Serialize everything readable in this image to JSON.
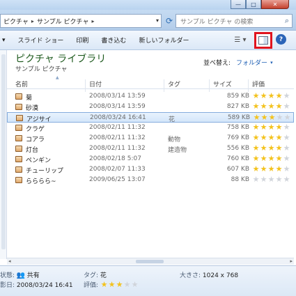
{
  "address": {
    "segments": [
      "ピクチャ",
      "サンプル ピクチャ"
    ],
    "search_placeholder": "サンプル ピクチャ の検索"
  },
  "toolbar": {
    "organize_caret": "▾",
    "slideshow": "スライド ショー",
    "print": "印刷",
    "burn": "書き込む",
    "new_folder": "新しいフォルダー",
    "help": "?"
  },
  "library": {
    "title": "ピクチャ ライブラリ",
    "subtitle": "サンプル ピクチャ",
    "arrange_label": "並べ替え:",
    "arrange_value": "フォルダー"
  },
  "columns": {
    "name": "名前",
    "date": "日付",
    "tag": "タグ",
    "size": "サイズ",
    "rating": "評価"
  },
  "files": [
    {
      "name": "菊",
      "date": "2008/03/14 13:59",
      "tag": "",
      "size": "859 KB",
      "rating": 4
    },
    {
      "name": "砂漠",
      "date": "2008/03/14 13:59",
      "tag": "",
      "size": "827 KB",
      "rating": 4
    },
    {
      "name": "アジサイ",
      "date": "2008/03/24 16:41",
      "tag": "花",
      "size": "589 KB",
      "rating": 3,
      "selected": true
    },
    {
      "name": "クラゲ",
      "date": "2008/02/11 11:32",
      "tag": "",
      "size": "758 KB",
      "rating": 4
    },
    {
      "name": "コアラ",
      "date": "2008/02/11 11:32",
      "tag": "動物",
      "size": "769 KB",
      "rating": 4
    },
    {
      "name": "灯台",
      "date": "2008/02/11 11:32",
      "tag": "建造物",
      "size": "556 KB",
      "rating": 4
    },
    {
      "name": "ペンギン",
      "date": "2008/02/18 5:07",
      "tag": "",
      "size": "760 KB",
      "rating": 4
    },
    {
      "name": "チューリップ",
      "date": "2008/02/07 11:33",
      "tag": "",
      "size": "607 KB",
      "rating": 4
    },
    {
      "name": "らららら~",
      "date": "2009/06/25 13:07",
      "tag": "",
      "size": "88 KB",
      "rating": 0
    }
  ],
  "details": {
    "state_label": "状態:",
    "state_value": "共有",
    "shot_label": "影日:",
    "shot_value": "2008/03/24 16:41",
    "tag_label": "タグ:",
    "tag_value": "花",
    "rating_label": "評価:",
    "rating_value": 3,
    "size_label": "大きさ:",
    "size_value": "1024 x 768"
  },
  "icons": [
    "refresh-icon",
    "search-icon",
    "view-options-icon",
    "preview-pane-icon",
    "help-icon",
    "image-file-icon",
    "shared-people-icon",
    "star-icon"
  ],
  "colors": {
    "highlight_border": "#e0141e",
    "star_on": "#f3c21c",
    "star_off": "#d0d4da",
    "library_title": "#1e5a1e",
    "link": "#1e5fb4",
    "selection": "#d4e6fa"
  }
}
